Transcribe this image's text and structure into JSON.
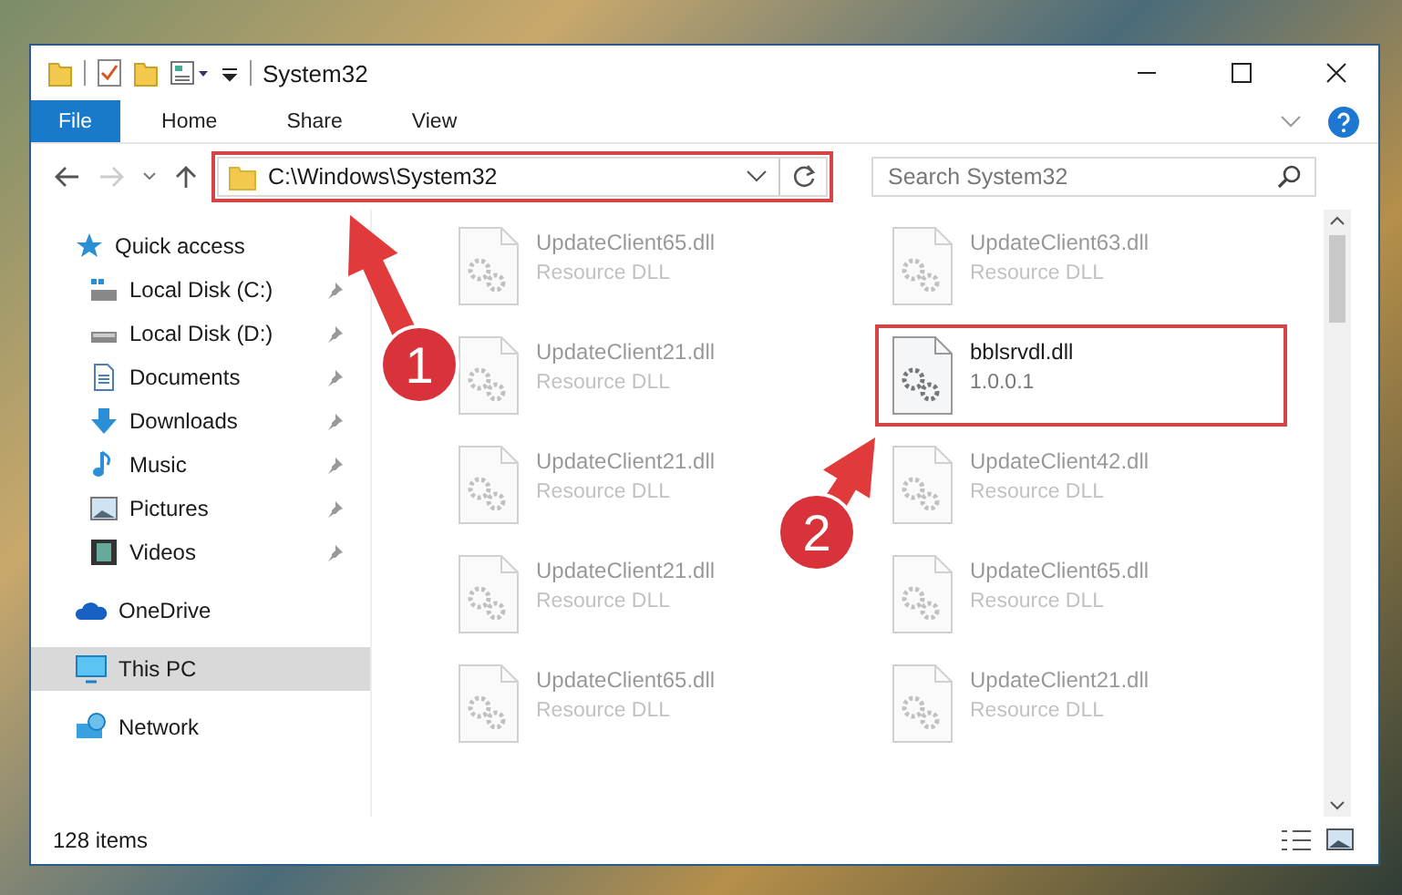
{
  "window": {
    "title": "System32"
  },
  "ribbon": {
    "tabs": [
      {
        "label": "File",
        "selected": true
      },
      {
        "label": "Home",
        "selected": false
      },
      {
        "label": "Share",
        "selected": false
      },
      {
        "label": "View",
        "selected": false
      }
    ]
  },
  "address": {
    "path": "C:\\Windows\\System32",
    "highlighted": true
  },
  "search": {
    "placeholder": "Search System32"
  },
  "sidebar": {
    "items": [
      {
        "label": "Quick access",
        "kind": "star",
        "selected": false,
        "children": [
          {
            "label": "Local Disk (C:)",
            "kind": "drive-c",
            "pinned": true
          },
          {
            "label": "Local Disk (D:)",
            "kind": "drive",
            "pinned": true
          },
          {
            "label": "Documents",
            "kind": "document",
            "pinned": true
          },
          {
            "label": "Downloads",
            "kind": "download",
            "pinned": true
          },
          {
            "label": "Music",
            "kind": "music",
            "pinned": true
          },
          {
            "label": "Pictures",
            "kind": "pictures",
            "pinned": true
          },
          {
            "label": "Videos",
            "kind": "videos",
            "pinned": true
          }
        ]
      },
      {
        "label": "OneDrive",
        "kind": "cloud",
        "selected": false
      },
      {
        "label": "This PC",
        "kind": "pc",
        "selected": true
      },
      {
        "label": "Network",
        "kind": "network",
        "selected": false
      }
    ]
  },
  "files": [
    {
      "name": "UpdateClient65.dll",
      "detail": "Resource DLL",
      "blurred": true,
      "highlighted": false
    },
    {
      "name": "UpdateClient63.dll",
      "detail": "Resource DLL",
      "blurred": true,
      "highlighted": false
    },
    {
      "name": "UpdateClient21.dll",
      "detail": "Resource DLL",
      "blurred": true,
      "highlighted": false
    },
    {
      "name": "bblsrvdl.dll",
      "detail": "1.0.0.1",
      "blurred": false,
      "highlighted": true
    },
    {
      "name": "UpdateClient21.dll",
      "detail": "Resource DLL",
      "blurred": true,
      "highlighted": false
    },
    {
      "name": "UpdateClient42.dll",
      "detail": "Resource DLL",
      "blurred": true,
      "highlighted": false
    },
    {
      "name": "UpdateClient21.dll",
      "detail": "Resource DLL",
      "blurred": true,
      "highlighted": false
    },
    {
      "name": "UpdateClient65.dll",
      "detail": "Resource DLL",
      "blurred": true,
      "highlighted": false
    },
    {
      "name": "UpdateClient65.dll",
      "detail": "Resource DLL",
      "blurred": true,
      "highlighted": false
    },
    {
      "name": "UpdateClient21.dll",
      "detail": "Resource DLL",
      "blurred": true,
      "highlighted": false
    }
  ],
  "status_bar": {
    "count": "128 items"
  },
  "annotations": [
    {
      "label": "1"
    },
    {
      "label": "2"
    }
  ]
}
